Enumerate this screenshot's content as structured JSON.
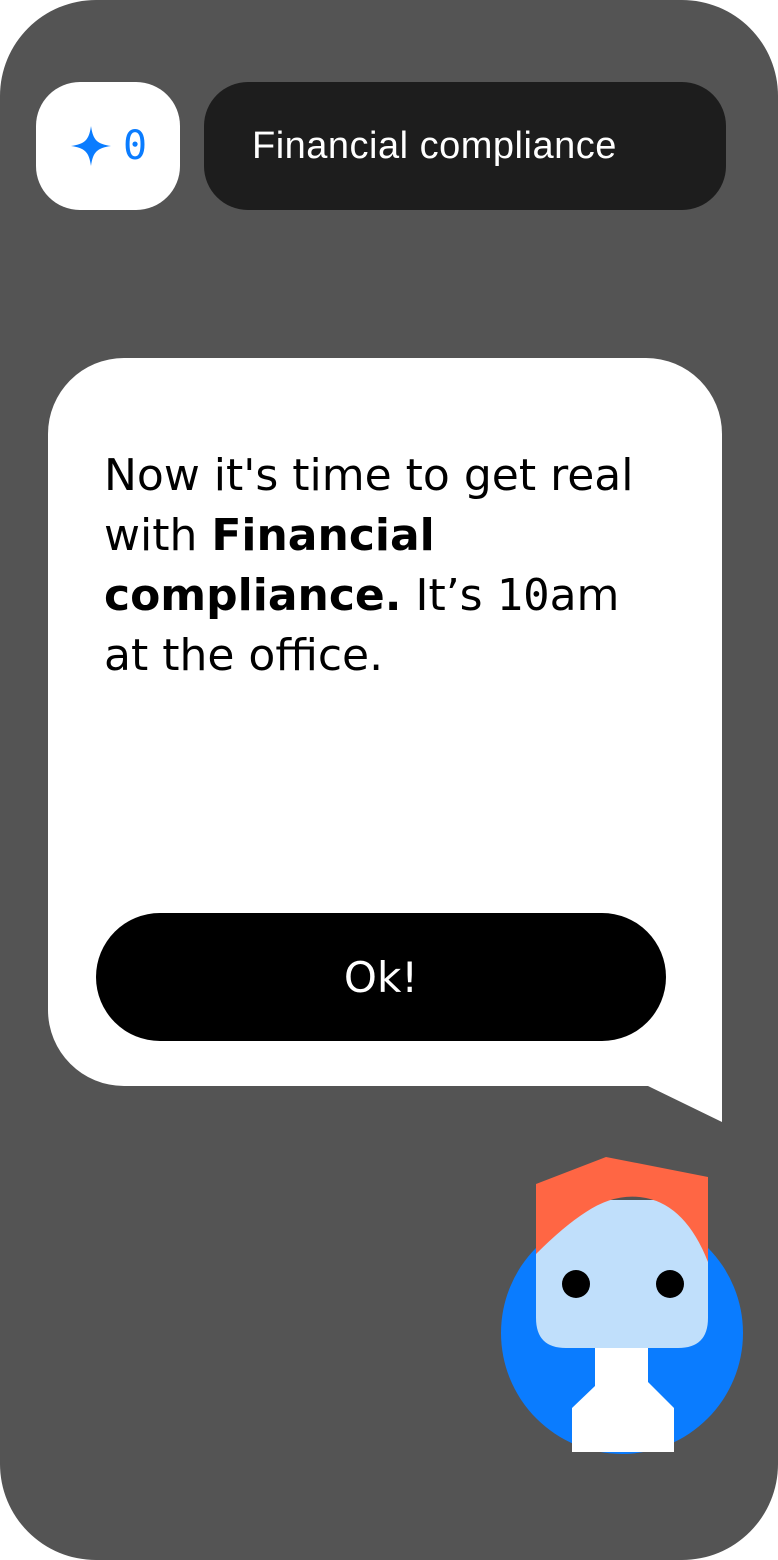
{
  "header": {
    "score": {
      "icon": "sparkle-icon",
      "value": "0"
    },
    "title": "Financial compliance"
  },
  "dialog": {
    "message": {
      "part1": "Now it's time to get real with ",
      "bold": "Financial compliance.",
      "part2": " It’s ",
      "time": "10",
      "part3": "am at the office."
    },
    "ok_label": "Ok!"
  },
  "avatar": {
    "icon": "character-avatar-icon"
  },
  "colors": {
    "background": "#545454",
    "accent": "#0a7cff",
    "hair": "#ff6644",
    "face": "#c0dffb",
    "button": "#000000"
  }
}
